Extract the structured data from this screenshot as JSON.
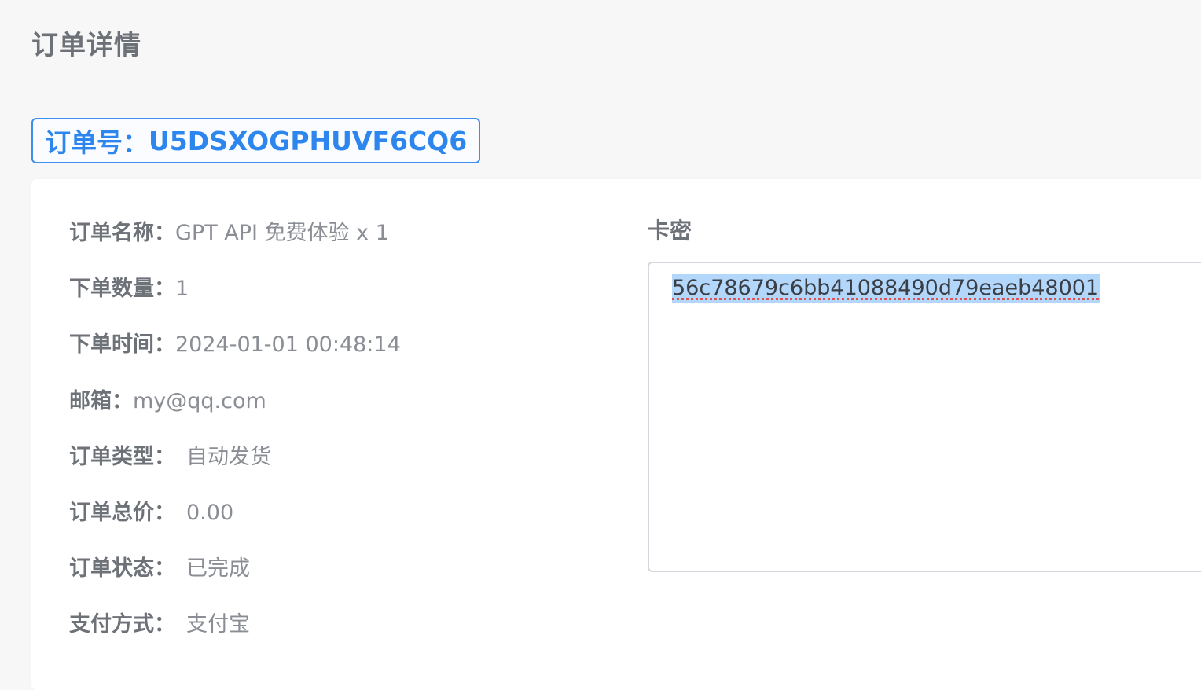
{
  "page": {
    "title": "订单详情"
  },
  "order": {
    "number_label": "订单号：",
    "number": "U5DSXOGPHUVF6CQ6"
  },
  "details": [
    {
      "label": "订单名称：",
      "value": "GPT API 免费体验 x 1"
    },
    {
      "label": "下单数量：",
      "value": "1"
    },
    {
      "label": "下单时间：",
      "value": "2024-01-01 00:48:14"
    },
    {
      "label": "邮箱：",
      "value": "my@qq.com"
    },
    {
      "label": "订单类型：",
      "value": "自动发货"
    },
    {
      "label": "订单总价：",
      "value": "0.00"
    },
    {
      "label": "订单状态：",
      "value": "已完成"
    },
    {
      "label": "支付方式：",
      "value": "支付宝"
    }
  ],
  "card_key": {
    "label": "卡密",
    "value": "56c78679c6bb41088490d79eaeb48001"
  }
}
